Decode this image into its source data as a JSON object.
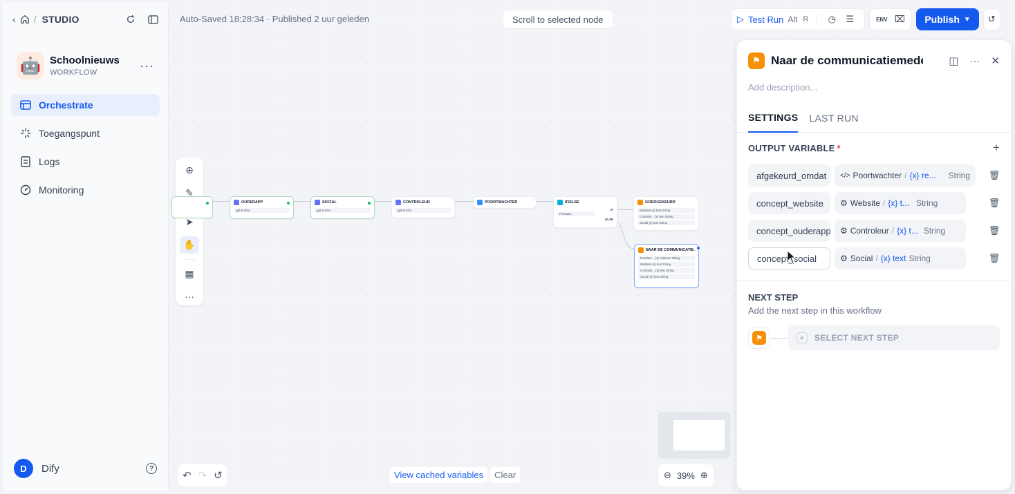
{
  "breadcrumb": {
    "section": "STUDIO"
  },
  "app": {
    "name": "Schoolnieuws",
    "type": "WORKFLOW",
    "icon": "🤖"
  },
  "nav": [
    {
      "label": "Orchestrate",
      "icon": "orchestrate-icon",
      "active": true
    },
    {
      "label": "Toegangspunt",
      "icon": "access-point-icon"
    },
    {
      "label": "Logs",
      "icon": "logs-icon"
    },
    {
      "label": "Monitoring",
      "icon": "monitoring-icon"
    }
  ],
  "user": {
    "initial": "D",
    "name": "Dify"
  },
  "topbar": {
    "status": "Auto-Saved 18:28:34 · Published 2 uur geleden",
    "scroll_button": "Scroll to selected node",
    "test_run": "Test Run",
    "test_run_kbd1": "Alt",
    "test_run_kbd2": "R",
    "publish": "Publish"
  },
  "nodes": [
    {
      "title": "OUDERAPP",
      "body": "gpt-5-mini",
      "color": "#6172f3"
    },
    {
      "title": "SOCIAL",
      "body": "gpt-5-mini",
      "color": "#6172f3"
    },
    {
      "title": "CONTROLEUR",
      "body": "gpt-5-mini",
      "color": "#6172f3"
    },
    {
      "title": "POORTWACHTER",
      "body": "",
      "color": "#2e90fa"
    },
    {
      "title": "IF/ELSE",
      "body": "Poortwa...",
      "color": "#06aed4",
      "if_label": "IF",
      "else_label": "ELSE"
    },
    {
      "title": "GOEDGEKEURD",
      "color": "#f79009",
      "rows": [
        "Website {x} text String",
        "Controle... {x} text String",
        "Social {x} text String"
      ]
    },
    {
      "title": "NAAR DE COMMUNICATIE...",
      "color": "#f79009",
      "rows": [
        "Poortwa... {x} redenen String",
        "Website {x} text String",
        "Controle... {x} text String",
        "Social {x} text String"
      ]
    }
  ],
  "bottom": {
    "view_cached": "View cached variables",
    "clear": "Clear",
    "zoom": "39%"
  },
  "panel": {
    "title": "Naar de communicatiemedewerker",
    "description_placeholder": "Add description...",
    "tabs": [
      "SETTINGS",
      "LAST RUN"
    ],
    "output_title": "OUTPUT VARIABLE",
    "required": "*",
    "variables": [
      {
        "name": "afgekeurd_omdat",
        "source": "Poortwachter",
        "var": "{x} re...",
        "type": "String",
        "source_icon": "code-icon"
      },
      {
        "name": "concept_website",
        "source": "Website",
        "var": "{x} t...",
        "type": "String",
        "source_icon": "llm-icon"
      },
      {
        "name": "concept_ouderapp",
        "source": "Controleur",
        "var": "{x} t...",
        "type": "String",
        "source_icon": "llm-icon"
      },
      {
        "name": "concept_social",
        "source": "Social",
        "var": "{x} text",
        "type": "String",
        "source_icon": "llm-icon"
      }
    ],
    "next_step_title": "NEXT STEP",
    "next_step_sub": "Add the next step in this workflow",
    "select_next": "SELECT NEXT STEP"
  }
}
